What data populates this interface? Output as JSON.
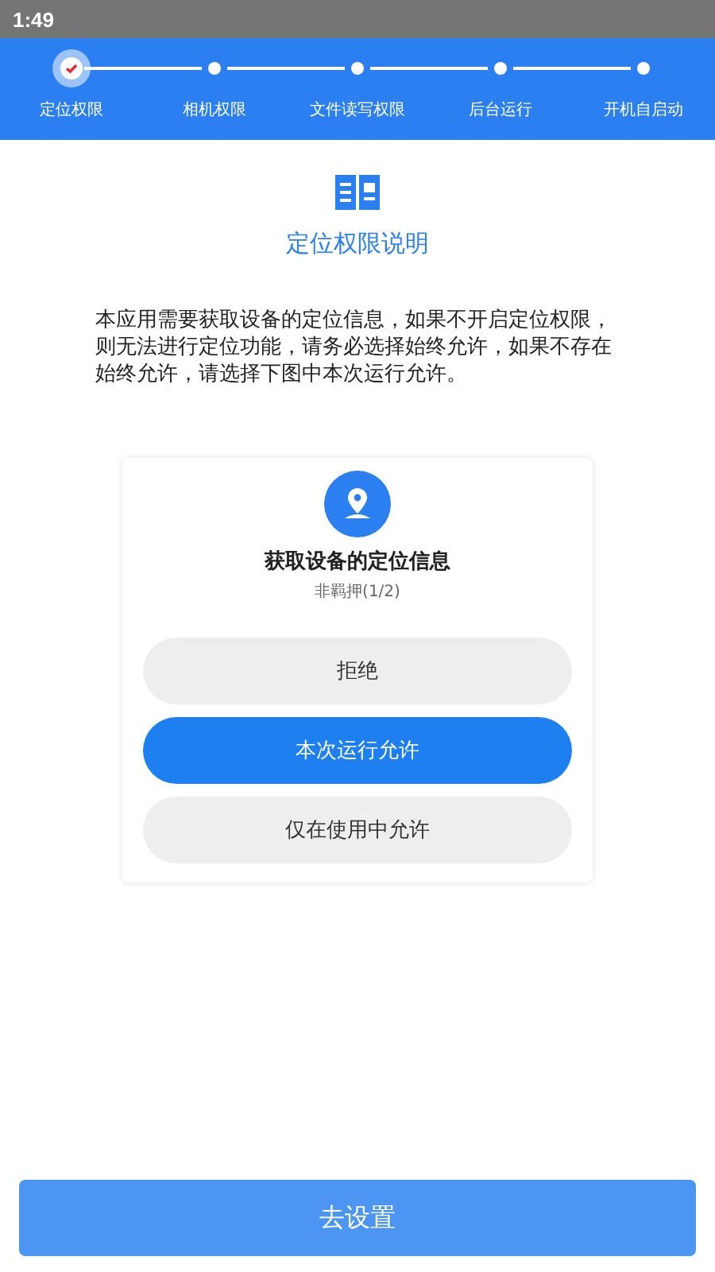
{
  "status_bar": {
    "time": "1:49"
  },
  "steps": [
    {
      "label": "定位权限",
      "selected": true
    },
    {
      "label": "相机权限",
      "selected": false
    },
    {
      "label": "文件读写权限",
      "selected": false
    },
    {
      "label": "后台运行",
      "selected": false
    },
    {
      "label": "开机自启动",
      "selected": false
    }
  ],
  "title": "定位权限说明",
  "description": "本应用需要获取设备的定位信息，如果不开启定位权限，则无法进行定位功能，请务必选择始终允许，如果不存在始终允许，请选择下图中本次运行允许。",
  "dialog": {
    "title": "获取设备的定位信息",
    "subtitle": "非羁押(1/2)",
    "options": [
      {
        "label": "拒绝",
        "selected": false
      },
      {
        "label": "本次运行允许",
        "selected": true
      },
      {
        "label": "仅在使用中允许",
        "selected": false
      }
    ]
  },
  "action_button": "去设置"
}
